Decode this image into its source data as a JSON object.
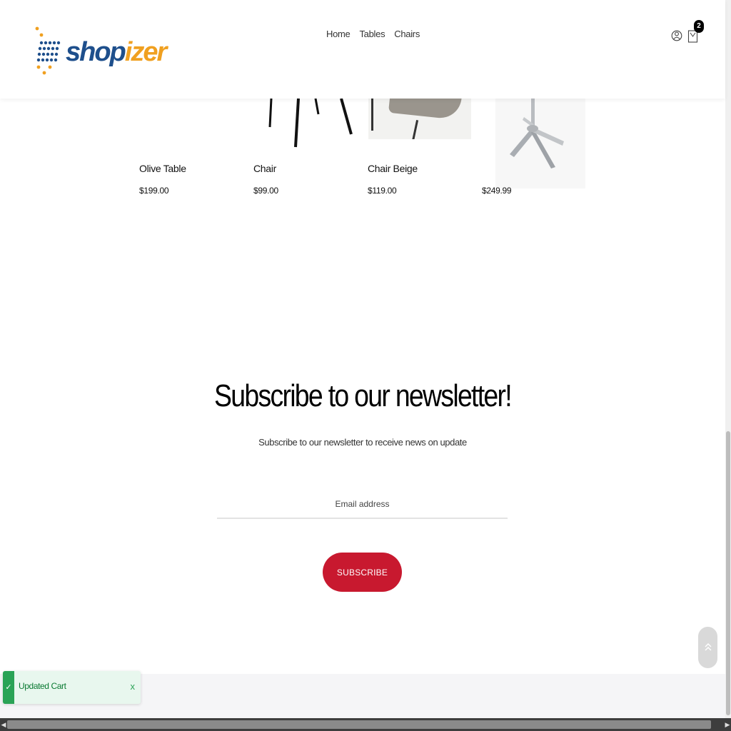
{
  "header": {
    "logo": {
      "part1": "shop",
      "part2": "izer"
    },
    "nav": [
      "Home",
      "Tables",
      "Chairs"
    ],
    "cart_count": "2"
  },
  "products": [
    {
      "name": "Olive Table",
      "price": "$199.00"
    },
    {
      "name": "Chair",
      "price": "$99.00"
    },
    {
      "name": "Chair Beige",
      "price": "$119.00"
    },
    {
      "name": "",
      "price": "$249.99"
    }
  ],
  "newsletter": {
    "title": "Subscribe to our newsletter!",
    "subtitle": "Subscribe to our newsletter to receive news on update",
    "email_placeholder": "Email address",
    "button_label": "SUBSCRIBE"
  },
  "toast": {
    "message": "Updated Cart",
    "close_label": "x"
  },
  "icons": {
    "user": "user-icon",
    "cart": "shopping-bag-icon",
    "scroll_top": "double-chevron-up-icon",
    "toast_check": "check-icon"
  },
  "colors": {
    "accent": "#c8192f",
    "logo_blue": "#1e4f8c",
    "logo_orange": "#f0a020",
    "toast_green": "#2aa356"
  }
}
